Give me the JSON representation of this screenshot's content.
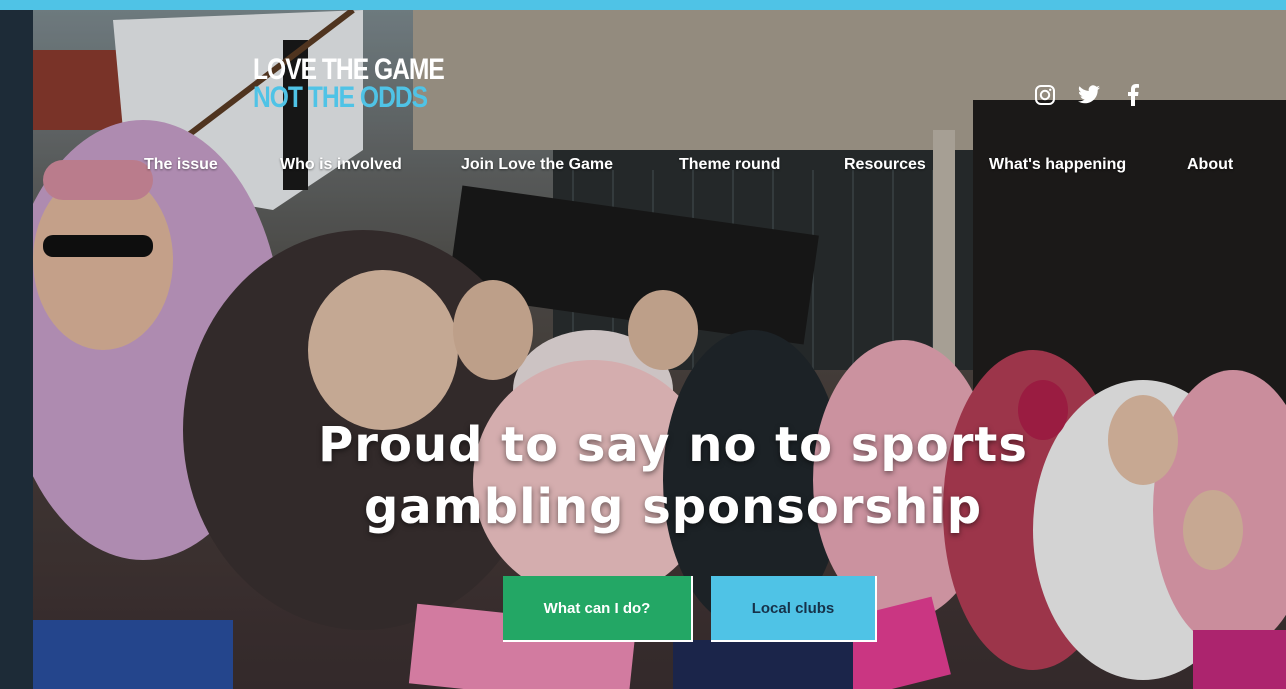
{
  "logo": {
    "line1": "LOVE THE GAME",
    "line2": "NOT THE ODDS"
  },
  "social": [
    {
      "name": "instagram-icon"
    },
    {
      "name": "twitter-icon"
    },
    {
      "name": "facebook-icon"
    }
  ],
  "nav": {
    "items": [
      {
        "label": "The issue"
      },
      {
        "label": "Who is involved"
      },
      {
        "label": "Join Love the Game"
      },
      {
        "label": "Theme round"
      },
      {
        "label": "Resources"
      },
      {
        "label": "What's happening"
      },
      {
        "label": "About"
      }
    ]
  },
  "hero": {
    "headline_line1": "Proud to say no to sports",
    "headline_line2": "gambling sponsorship",
    "primary_button": "What can I do?",
    "secondary_button": "Local clubs"
  },
  "colors": {
    "accent_blue": "#4fc3e6",
    "accent_green": "#23a765",
    "rail": "#1d2b37"
  }
}
